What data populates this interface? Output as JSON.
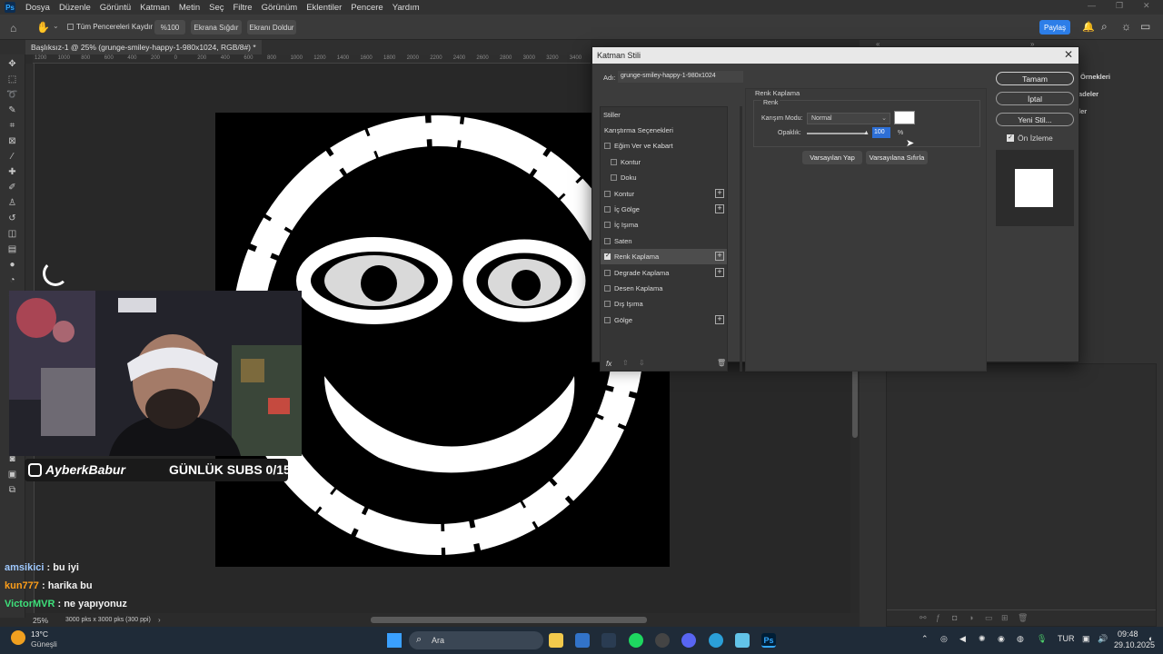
{
  "menubar": {
    "app_logo": "Ps",
    "items": [
      "Dosya",
      "Düzenle",
      "Görüntü",
      "Katman",
      "Metin",
      "Seç",
      "Filtre",
      "Görünüm",
      "Eklentiler",
      "Pencere",
      "Yardım"
    ]
  },
  "optionsbar": {
    "scroll_all_label": "Tüm Pencereleri Kaydır",
    "zoom_btn": "%100",
    "fit_btn": "Ekrana Sığdır",
    "fill_btn": "Ekranı Doldur",
    "share_btn": "Paylaş"
  },
  "document": {
    "tab_title": "Başlıksız-1 @ 25% (grunge-smiley-happy-1-980x1024, RGB/8#) *",
    "ruler_marks": [
      "1200",
      "1000",
      "800",
      "600",
      "400",
      "200",
      "0",
      "200",
      "400",
      "600",
      "800",
      "1000",
      "1200",
      "1400",
      "1600",
      "1800",
      "2000",
      "2200",
      "2400",
      "2600",
      "2800",
      "3000",
      "3200",
      "3400"
    ]
  },
  "statusbar": {
    "zoom": "25%",
    "doc_info": "3000 pks x 3000 pks (300 ppi)"
  },
  "rightpanel": {
    "labels": [
      "Örnekleri",
      "adeler",
      "ler"
    ]
  },
  "dialog": {
    "title": "Katman Stili",
    "name_label": "Adı:",
    "name_value": "grunge-smiley-happy-1-980x1024",
    "styles_header": "Stiller",
    "styles": [
      {
        "label": "Karıştırma Seçenekleri",
        "checkbox": false,
        "plus": false,
        "indent": 0,
        "checked": false
      },
      {
        "label": "Eğim Ver ve Kabart",
        "checkbox": true,
        "plus": false,
        "indent": 0,
        "checked": false
      },
      {
        "label": "Kontur",
        "checkbox": true,
        "plus": false,
        "indent": 1,
        "checked": false
      },
      {
        "label": "Doku",
        "checkbox": true,
        "plus": false,
        "indent": 1,
        "checked": false
      },
      {
        "label": "Kontur",
        "checkbox": true,
        "plus": true,
        "indent": 0,
        "checked": false
      },
      {
        "label": "İç Gölge",
        "checkbox": true,
        "plus": true,
        "indent": 0,
        "checked": false
      },
      {
        "label": "İç Işıma",
        "checkbox": true,
        "plus": false,
        "indent": 0,
        "checked": false
      },
      {
        "label": "Saten",
        "checkbox": true,
        "plus": false,
        "indent": 0,
        "checked": false
      },
      {
        "label": "Renk Kaplama",
        "checkbox": true,
        "plus": true,
        "indent": 0,
        "checked": true
      },
      {
        "label": "Degrade Kaplama",
        "checkbox": true,
        "plus": true,
        "indent": 0,
        "checked": false
      },
      {
        "label": "Desen Kaplama",
        "checkbox": true,
        "plus": false,
        "indent": 0,
        "checked": false
      },
      {
        "label": "Dış Işıma",
        "checkbox": true,
        "plus": false,
        "indent": 0,
        "checked": false
      },
      {
        "label": "Gölge",
        "checkbox": true,
        "plus": true,
        "indent": 0,
        "checked": false
      }
    ],
    "fx_label": "fx",
    "section_title": "Renk Kaplama",
    "group_title": "Renk",
    "blend_label": "Karışım Modu:",
    "blend_value": "Normal",
    "opacity_label": "Opaklık:",
    "opacity_value": "100",
    "opacity_unit": "%",
    "overlay_color": "#ffffff",
    "btn_make_default": "Varsayılan Yap",
    "btn_reset_default": "Varsayılana Sıfırla",
    "btn_ok": "Tamam",
    "btn_cancel": "İptal",
    "btn_new_style": "Yeni Stil...",
    "preview_label": "Ön İzleme",
    "preview_checked": true
  },
  "stream": {
    "username": "AyberkBabur",
    "subs": "GÜNLÜK SUBS 0/15",
    "chat": [
      {
        "user": "amsikici",
        "user_color": "#9fc9ff",
        "text": " : bu iyi"
      },
      {
        "user": "kun777",
        "user_color": "#ff9f1a",
        "text": " : harika bu"
      },
      {
        "user": "VictorMVR",
        "user_color": "#3ee07a",
        "text": " : ne yapıyonuz"
      }
    ]
  },
  "taskbar": {
    "weather_temp": "13°C",
    "weather_desc": "Güneşli",
    "search_label": "Ara",
    "lang": "TUR",
    "time": "09:48",
    "date": "29.10.2025"
  }
}
